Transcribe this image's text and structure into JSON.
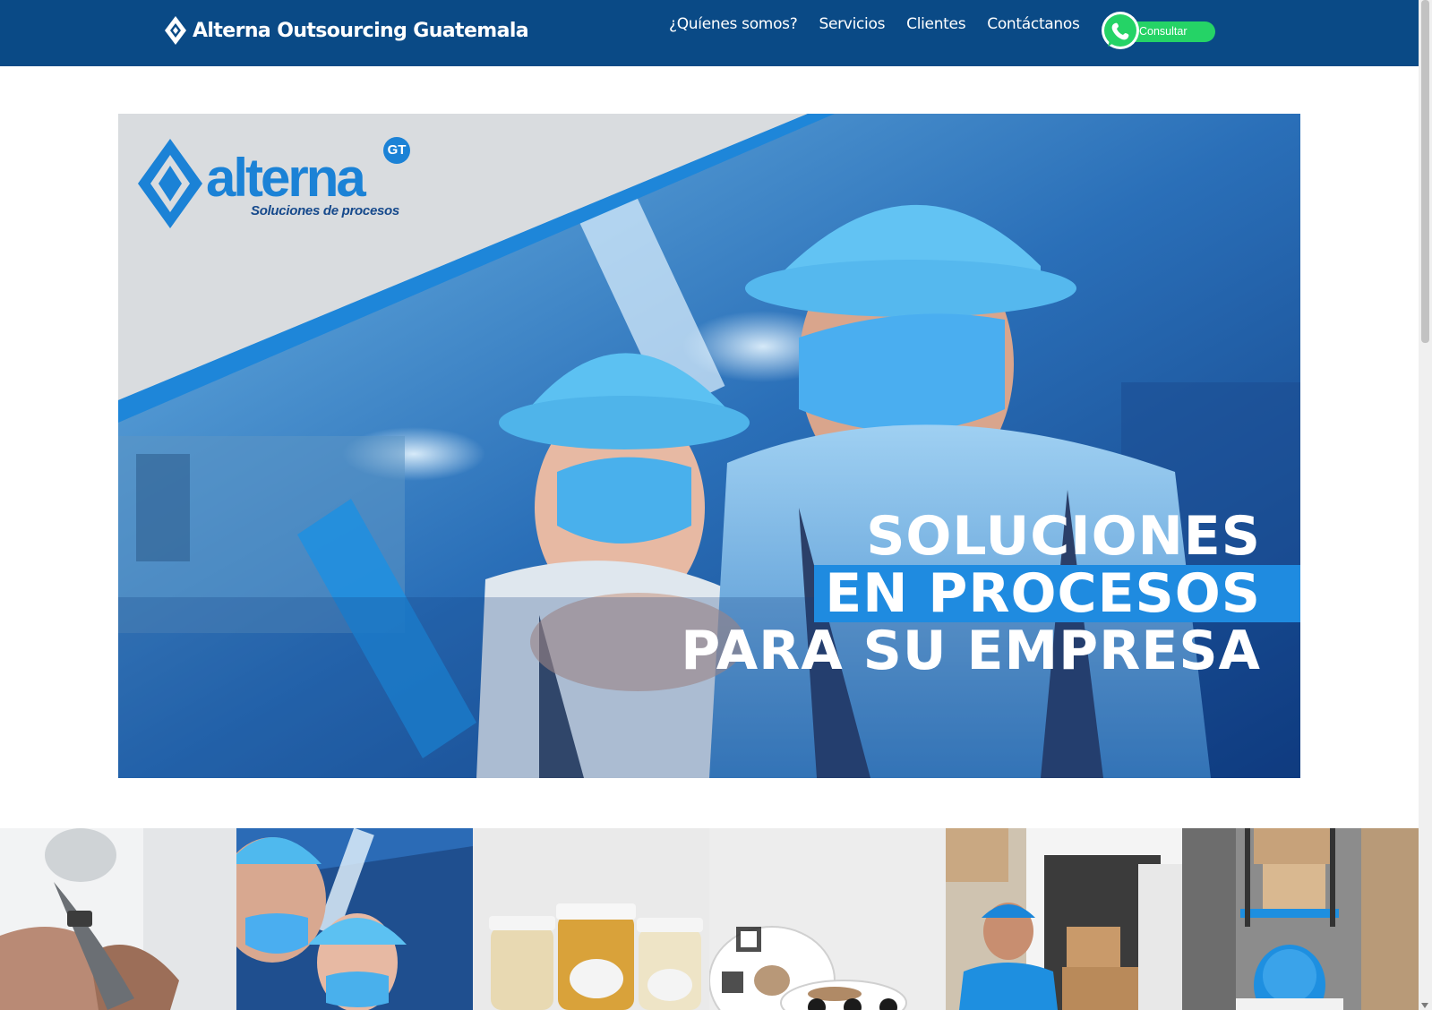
{
  "header": {
    "brand_name": "Alterna Outsourcing Guatemala",
    "nav": [
      "¿Quíenes somos?",
      "Servicios",
      "Clientes",
      "Contáctanos"
    ],
    "whatsapp_label": "Consultar"
  },
  "hero": {
    "logo_word": "alterna",
    "logo_badge": "GT",
    "logo_tagline": "Soluciones de procesos",
    "headline": [
      "SOLUCIONES",
      "EN PROCESOS",
      "PARA SU EMPRESA"
    ]
  },
  "thumbnails": [
    "hands-together-photo",
    "workers-hardhats-photo",
    "spice-jars-photo",
    "label-rolls-photo",
    "delivery-van-photo",
    "warehouse-forklift-photo"
  ],
  "colors": {
    "header_bg": "#0a4a86",
    "accent_blue": "#1f8be0",
    "whatsapp_green": "#25d366"
  }
}
